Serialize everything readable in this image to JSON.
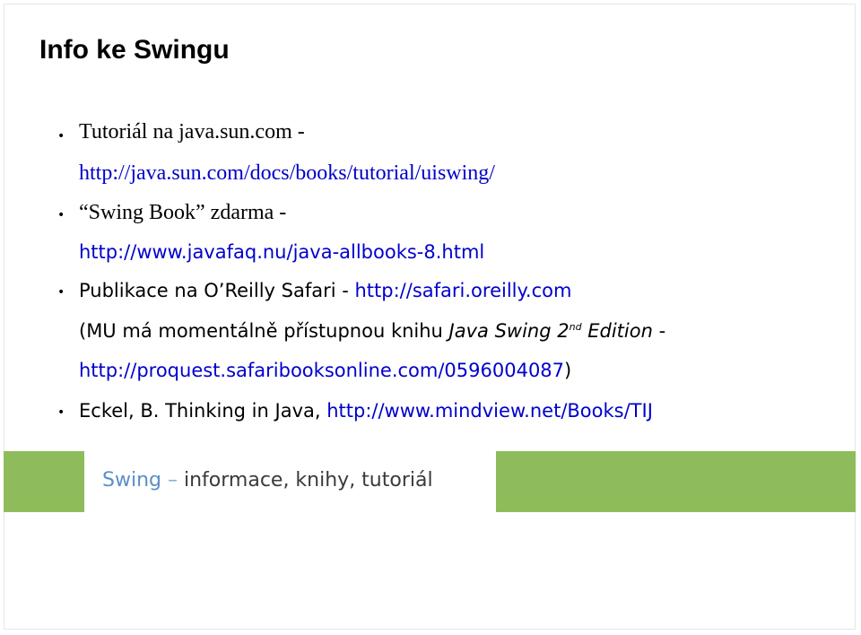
{
  "slide": {
    "title": "Info ke Swingu"
  },
  "bullets": {
    "symbol": "•",
    "item1_line1": "Tutoriál na java.sun.com -",
    "item1_line2": "http://java.sun.com/docs/books/tutorial/uiswing/",
    "item2_line1": "“Swing Book” zdarma -",
    "item2_line2": "http://www.javafaq.nu/java-allbooks-8.html",
    "item3_prefix": "Publikace na O’Reilly Safari - ",
    "item3_link": "http://safari.oreilly.com",
    "item3_paren_prefix": "(MU má momentálně přístupnou knihu ",
    "item3_book_title": "Java Swing 2",
    "item3_book_sup": "nd",
    "item3_book_edition": " Edition",
    "item3_paren_dash": " -",
    "item3_paren_link": "http://proquest.safaribooksonline.com/0596004087",
    "item3_paren_close": ")",
    "item4_prefix": "Eckel, B. Thinking in Java, ",
    "item4_link": "http://www.mindview.net/Books/TIJ"
  },
  "footer": {
    "topic": "Swing",
    "separator": " – ",
    "subtitle": "informace, knihy, tutoriál"
  },
  "colors": {
    "link": "#0000cc",
    "footer_green": "#8fbc5b",
    "footer_topic": "#5b8ec8",
    "footer_separator": "#8aaad0",
    "footer_subtitle": "#3a3a3a",
    "frame_border": "#e6e6e6"
  }
}
